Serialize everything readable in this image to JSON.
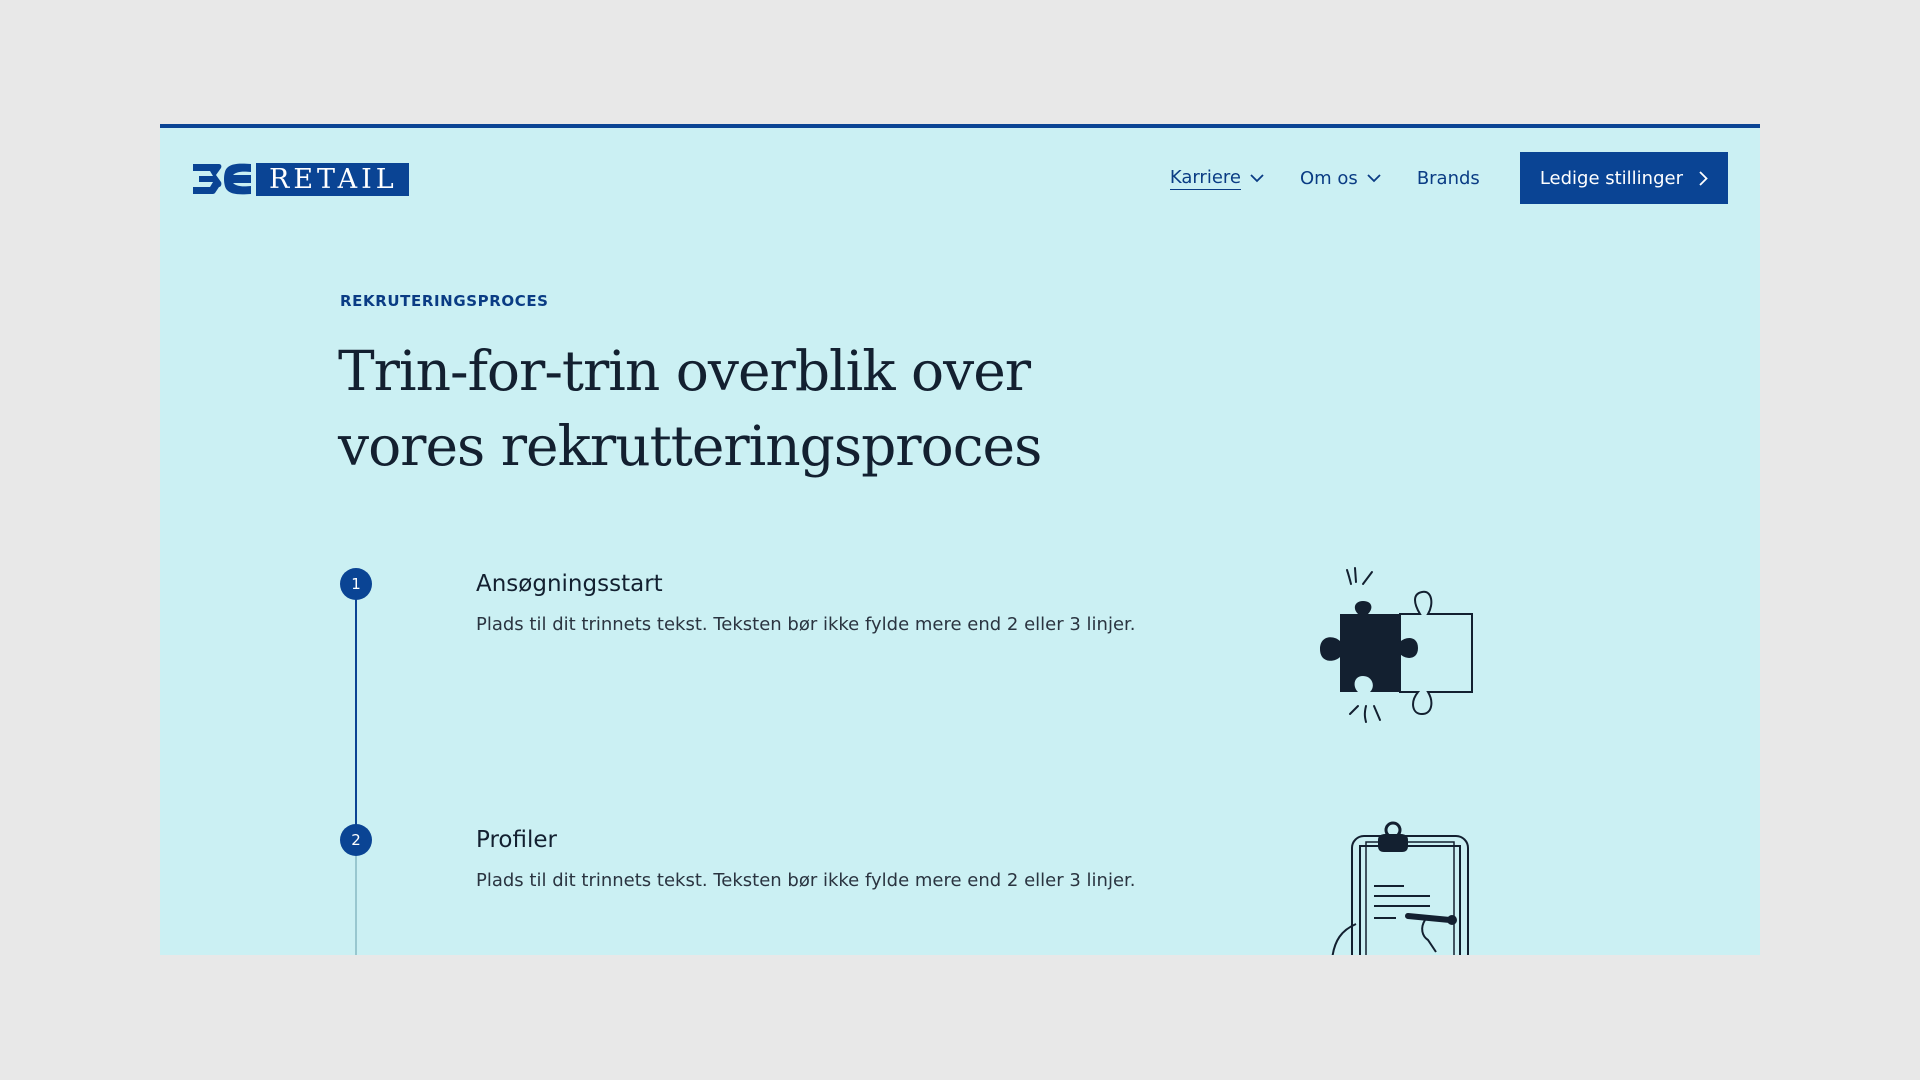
{
  "brand": {
    "logo_text": "RETAIL",
    "logo_mark": "3C",
    "primary_color": "#0a4494",
    "background_color": "#cbf0f3"
  },
  "nav": {
    "items": [
      {
        "label": "Karriere",
        "has_dropdown": true,
        "active": true
      },
      {
        "label": "Om os",
        "has_dropdown": true,
        "active": false
      },
      {
        "label": "Brands",
        "has_dropdown": false,
        "active": false
      }
    ],
    "cta_label": "Ledige stillinger",
    "cta_icon": "chevron-right-icon"
  },
  "hero": {
    "eyebrow": "REKRUTERINGSPROCES",
    "title": "Trin-for-trin overblik over vores rekrutteringsproces"
  },
  "steps": [
    {
      "number": "1",
      "title": "Ansøgningsstart",
      "text": "Plads til dit trinnets tekst. Teksten bør ikke fylde mere end 2 eller 3 linjer.",
      "illustration": "puzzle-icon"
    },
    {
      "number": "2",
      "title": "Profiler",
      "text": "Plads til dit trinnets tekst. Teksten bør ikke fylde mere end 2 eller 3 linjer.",
      "illustration": "clipboard-icon"
    }
  ]
}
